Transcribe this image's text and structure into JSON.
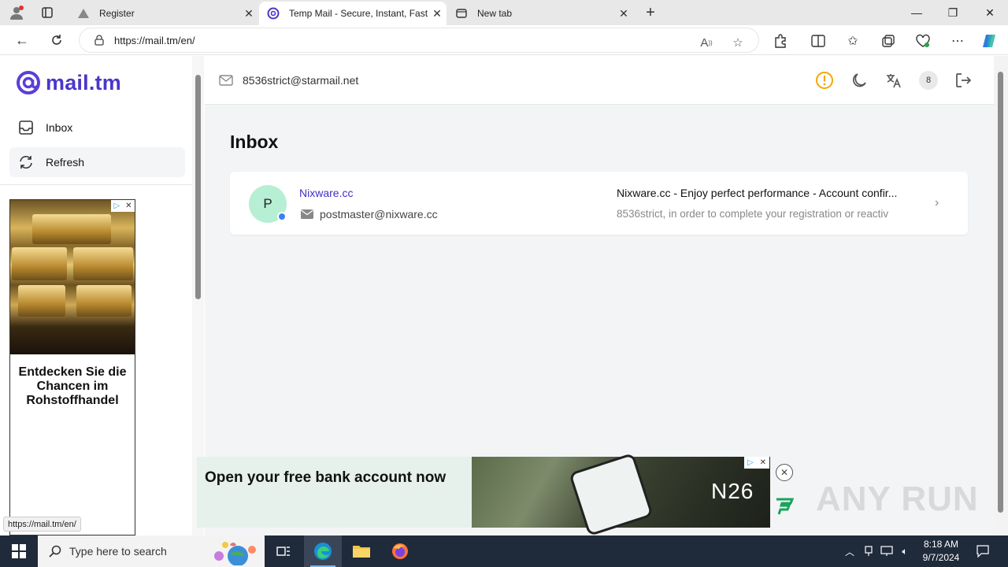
{
  "browser": {
    "tabs": [
      {
        "label": "Register",
        "icon": "warning-triangle-icon"
      },
      {
        "label": "Temp Mail - Secure, Instant, Fast",
        "icon": "mailtm-at-icon",
        "active": true
      },
      {
        "label": "New tab",
        "icon": "newtab-icon"
      }
    ],
    "url": "https://mail.tm/en/",
    "status_url": "https://mail.tm/en/"
  },
  "sidebar": {
    "logo_text": "mail.tm",
    "items": [
      {
        "label": "Inbox",
        "icon": "inbox-icon"
      },
      {
        "label": "Refresh",
        "icon": "refresh-icon"
      }
    ],
    "ad": {
      "headline": "Entdecken Sie die Chancen im Rohstoffhandel"
    }
  },
  "header": {
    "email": "8536strict@starmail.net",
    "badge_count": "8"
  },
  "main": {
    "title": "Inbox",
    "messages": [
      {
        "avatar_letter": "P",
        "sender_name": "Nixware.cc",
        "sender_email": "postmaster@nixware.cc",
        "subject": "Nixware.cc - Enjoy perfect performance - Account confir...",
        "preview": "8536strict, in order to complete your registration or reactiv"
      }
    ]
  },
  "bottom_ad": {
    "headline": "Open your free bank account now",
    "brand": "N26"
  },
  "watermark": "ANY RUN",
  "taskbar": {
    "search_placeholder": "Type here to search",
    "time": "8:18 AM",
    "date": "9/7/2024"
  },
  "colors": {
    "brand": "#4a36c9",
    "accent_dot": "#3b82f6",
    "avatar_bg": "#b6efd3",
    "warning": "#f2a900"
  }
}
